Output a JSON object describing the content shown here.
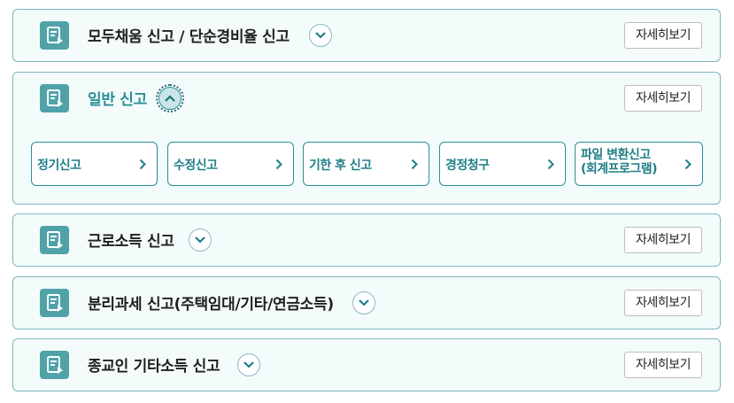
{
  "sections": [
    {
      "title": "모두채움 신고 / 단순경비율 신고",
      "detail_label": "자세히보기",
      "expanded": false
    },
    {
      "title": "일반 신고",
      "detail_label": "자세히보기",
      "expanded": true,
      "sub_items": [
        {
          "label": "정기신고"
        },
        {
          "label": "수정신고"
        },
        {
          "label": "기한 후 신고"
        },
        {
          "label": "경정청구"
        },
        {
          "label_line1": "파일 변환신고",
          "label_line2": "(회계프로그램)"
        }
      ]
    },
    {
      "title": "근로소득 신고",
      "detail_label": "자세히보기",
      "expanded": false
    },
    {
      "title": "분리과세 신고(주택임대/기타/연금소득)",
      "detail_label": "자세히보기",
      "expanded": false
    },
    {
      "title": "종교인 기타소득 신고",
      "detail_label": "자세히보기",
      "expanded": false
    }
  ],
  "colors": {
    "accent": "#2a8f97",
    "icon_bg": "#4fa3a8",
    "panel_bg": "#f4fbfb",
    "border": "#7fb7bd"
  },
  "icons": {
    "section": "document-edit-icon",
    "toggle_closed": "chevron-down-icon",
    "toggle_open": "chevron-up-icon",
    "sub_item": "chevron-right-icon"
  }
}
